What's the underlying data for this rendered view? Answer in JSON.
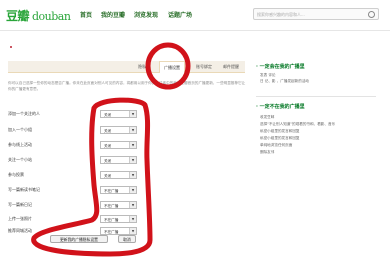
{
  "header": {
    "logo_cn": "豆瓣",
    "logo_en": "douban",
    "nav": [
      "首页",
      "我的豆瓣",
      "浏览发现",
      "话题广场"
    ],
    "search_placeholder": "搜索你感兴趣的内容和人..."
  },
  "tabs": [
    "隐私",
    "广播设置",
    "账号绑定",
    "邮件提醒"
  ],
  "intro": "你可以自己选择一些你的动态是否广播。你未在此页面对别人可见的内容，将都用以用于你的关注者中的我的豆瓣首页的广播更新，一些明显推荐它让你的广播更有意思。",
  "settings": [
    {
      "label": "添加一个关注的人",
      "value": "关闭"
    },
    {
      "label": "加入一个小组",
      "value": "关闭"
    },
    {
      "label": "参与线上活动",
      "value": "关闭"
    },
    {
      "label": "关注一个小站",
      "value": "关闭"
    },
    {
      "label": "参与投票",
      "value": "关闭"
    },
    {
      "label": "写一篇新读书笔记",
      "value": "不在广播"
    },
    {
      "label": "写一篇新日记",
      "value": "不在广播"
    },
    {
      "label": "上传一张照片",
      "value": "不在广播"
    },
    {
      "label": "推荐同城活动",
      "value": "不在广播"
    }
  ],
  "buttons": {
    "save": "更新我的广播隐私设置",
    "cancel": "取消"
  },
  "sidebar": {
    "section1_title": "· 一定会在我的广播里",
    "section1_lines": [
      "发表 评论",
      "日 记、影 ，广播发起新的活动"
    ],
    "section2_title": "· 一定不在我的广播里",
    "section2_lines": [
      "收发豆邮",
      "选择\"不让别人知道\"的观看的书和、看影、音乐",
      "私密小组里的发言和回复",
      "私密小组里的发言和回复",
      "单纯地浏览任何页面",
      "删除友邻"
    ]
  },
  "colors": {
    "brand_green": "#2aa53a",
    "annotation_red": "#d1121a"
  }
}
